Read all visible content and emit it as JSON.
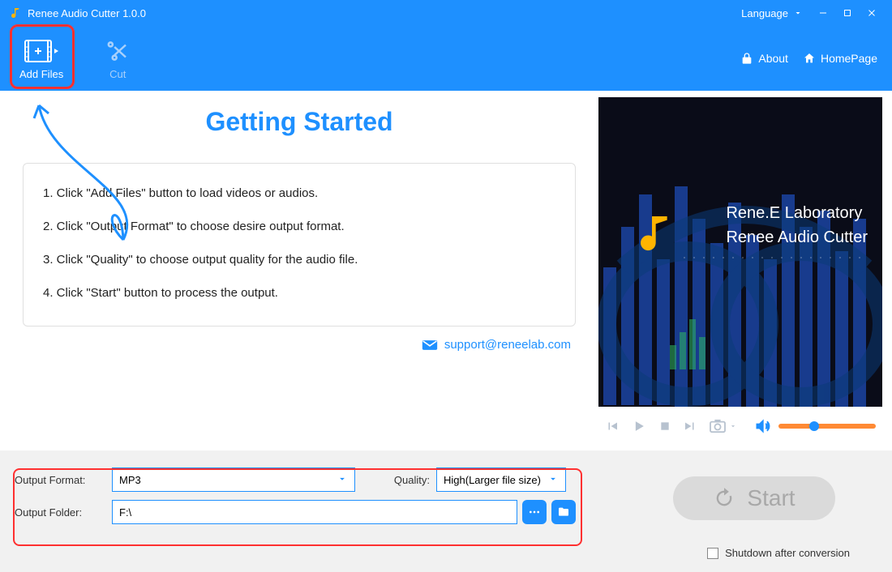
{
  "titlebar": {
    "title": "Renee Audio Cutter 1.0.0",
    "language_label": "Language"
  },
  "toolbar": {
    "add_files_label": "Add Files",
    "cut_label": "Cut",
    "about_label": "About",
    "homepage_label": "HomePage"
  },
  "guide": {
    "heading": "Getting Started",
    "steps": [
      "1. Click \"Add Files\" button to load videos or audios.",
      "2. Click \"Output Format\" to choose desire output format.",
      "3. Click \"Quality\" to choose output quality for the audio file.",
      "4. Click \"Start\" button to process the output."
    ],
    "support_email": "support@reneelab.com"
  },
  "preview": {
    "brand_line1": "Rene.E Laboratory",
    "brand_line2": "Renee Audio Cutter"
  },
  "settings": {
    "output_format_label": "Output Format:",
    "output_format_value": "MP3",
    "quality_label": "Quality:",
    "quality_value": "High(Larger file size)",
    "output_folder_label": "Output Folder:",
    "output_folder_value": "F:\\"
  },
  "actions": {
    "start_label": "Start",
    "shutdown_label": "Shutdown after conversion"
  },
  "colors": {
    "accent": "#1e90ff",
    "highlight": "#ff3030"
  }
}
